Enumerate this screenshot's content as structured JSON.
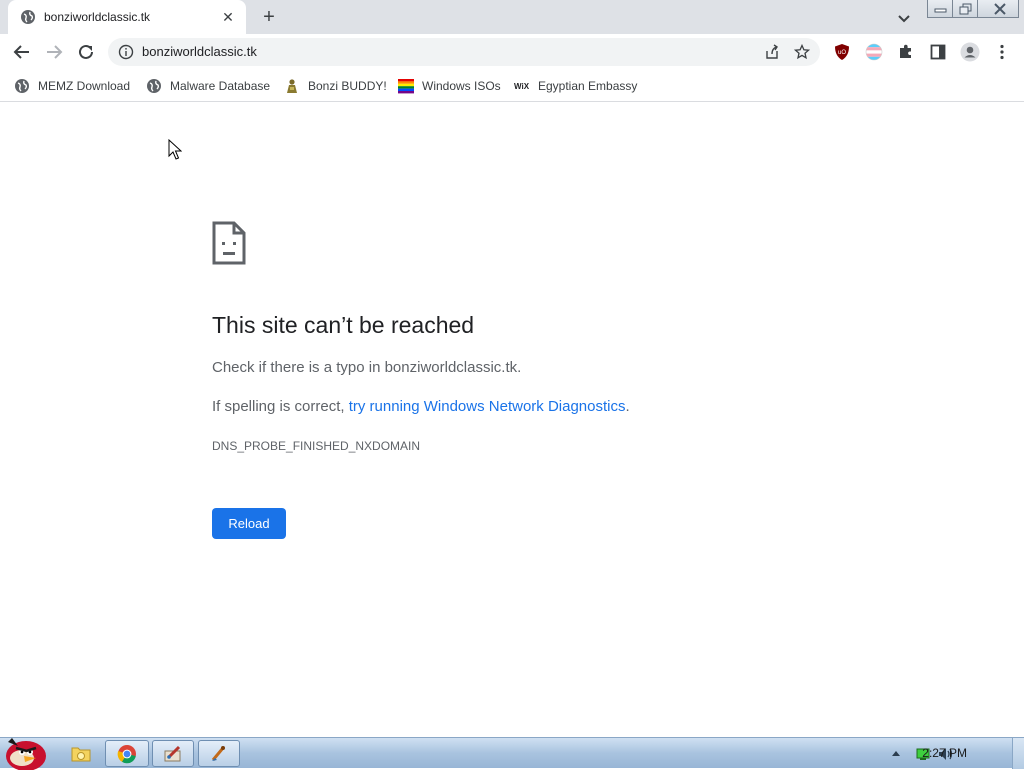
{
  "tab": {
    "title": "bonziworldclassic.tk",
    "close": "✕"
  },
  "newtab": "+",
  "omnibox": {
    "url": "bonziworldclassic.tk"
  },
  "bookmarks": [
    {
      "label": "MEMZ Download",
      "icon": "globe-icon"
    },
    {
      "label": "Malware Database",
      "icon": "globe-icon"
    },
    {
      "label": "Bonzi BUDDY!",
      "icon": "bonzi-icon"
    },
    {
      "label": "Windows ISOs",
      "icon": "windows-flag-icon"
    },
    {
      "label": "Egyptian Embassy",
      "icon": "wix-icon"
    }
  ],
  "error": {
    "title": "This site can’t be reached",
    "line1": "Check if there is a typo in bonziworldclassic.tk.",
    "line2_prefix": "If spelling is correct, ",
    "line2_link": "try running Windows Network Diagnostics",
    "line2_suffix": ".",
    "code": "DNS_PROBE_FINISHED_NXDOMAIN",
    "reload": "Reload"
  },
  "taskbar": {
    "clock": "2:27 PM"
  },
  "colors": {
    "accent": "#1a73e8",
    "tabstrip": "#dee1e6",
    "taskbar": "#a9c3df"
  }
}
